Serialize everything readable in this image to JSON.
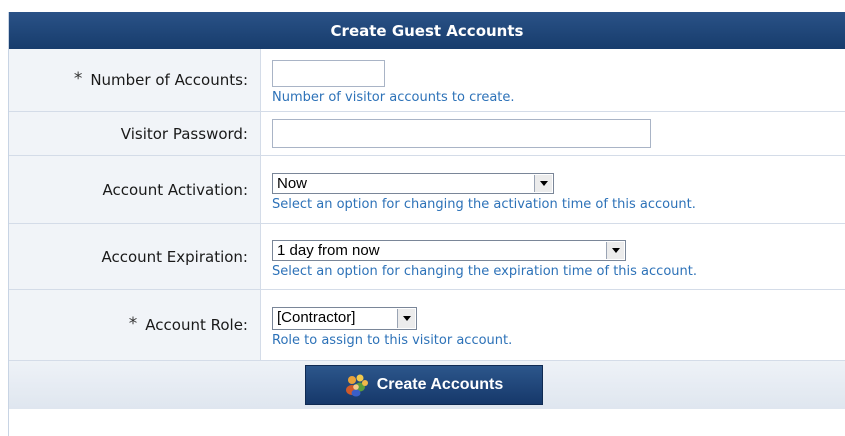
{
  "form": {
    "title": "Create Guest Accounts",
    "required_marker": "*",
    "fields": [
      {
        "label": "Number of Accounts:",
        "value": "",
        "hint": "Number of visitor accounts to create."
      },
      {
        "label": "Visitor Password:",
        "value": ""
      },
      {
        "label": "Account Activation:",
        "selected": "Now",
        "hint": "Select an option for changing the activation time of this account."
      },
      {
        "label": "Account Expiration:",
        "selected": "1 day from now",
        "hint": "Select an option for changing the expiration time of this account."
      },
      {
        "label": "Account Role:",
        "selected": "[Contractor]",
        "hint": "Role to assign to this visitor account."
      }
    ]
  },
  "footer": {
    "submit_label": "Create Accounts",
    "submit_icon": "users-group-icon"
  },
  "colors": {
    "header_bg": "#1f4677",
    "hint_text": "#2d72b8",
    "label_bg": "#f1f4f8"
  }
}
